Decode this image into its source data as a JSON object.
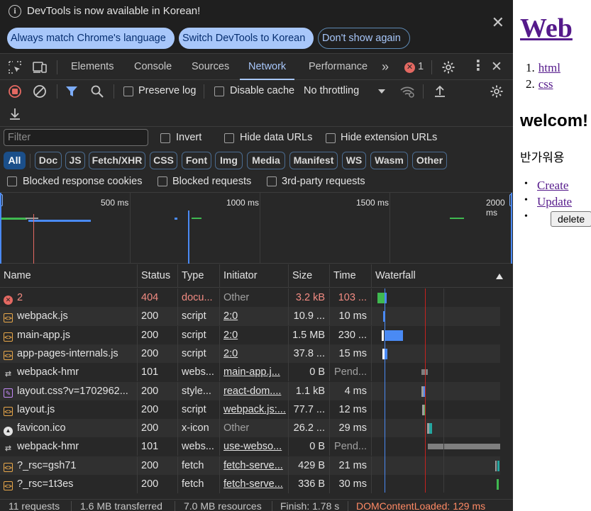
{
  "infobar": {
    "message": "DevTools is now available in Korean!",
    "always_match": "Always match Chrome's language",
    "switch_korean": "Switch DevTools to Korean",
    "dont_show": "Don't show again"
  },
  "tabs": [
    "Elements",
    "Console",
    "Sources",
    "Network",
    "Performance"
  ],
  "active_tab": "Network",
  "more_tabs_glyph": "»",
  "error_count": "1",
  "toolbar": {
    "preserve_log": "Preserve log",
    "disable_cache": "Disable cache",
    "throttling": "No throttling"
  },
  "filter": {
    "placeholder": "Filter",
    "invert": "Invert",
    "hide_data_urls": "Hide data URLs",
    "hide_extension_urls": "Hide extension URLs",
    "types": [
      "All",
      "Doc",
      "JS",
      "Fetch/XHR",
      "CSS",
      "Font",
      "Img",
      "Media",
      "Manifest",
      "WS",
      "Wasm",
      "Other"
    ],
    "blocked_response_cookies": "Blocked response cookies",
    "blocked_requests": "Blocked requests",
    "third_party": "3rd-party requests"
  },
  "overview": {
    "ticks": [
      "500 ms",
      "1000 ms",
      "1500 ms",
      "2000 ms"
    ]
  },
  "columns": {
    "name": "Name",
    "status": "Status",
    "type": "Type",
    "initiator": "Initiator",
    "size": "Size",
    "time": "Time",
    "waterfall": "Waterfall"
  },
  "rows": [
    {
      "name": "2",
      "status": "404",
      "type": "docu...",
      "initiator": "Other",
      "size": "3.2 kB",
      "time": "103 ...",
      "kind": "error"
    },
    {
      "name": "webpack.js",
      "status": "200",
      "type": "script",
      "initiator": "2:0",
      "size": "10.9 ...",
      "time": "10 ms",
      "kind": "script"
    },
    {
      "name": "main-app.js",
      "status": "200",
      "type": "script",
      "initiator": "2:0",
      "size": "1.5 MB",
      "time": "230 ...",
      "kind": "script"
    },
    {
      "name": "app-pages-internals.js",
      "status": "200",
      "type": "script",
      "initiator": "2:0",
      "size": "37.8 ...",
      "time": "15 ms",
      "kind": "script"
    },
    {
      "name": "webpack-hmr",
      "status": "101",
      "type": "webs...",
      "initiator": "main-app.j...",
      "size": "0 B",
      "time": "Pend...",
      "kind": "ws"
    },
    {
      "name": "layout.css?v=1702962...",
      "status": "200",
      "type": "style...",
      "initiator": "react-dom....",
      "size": "1.1 kB",
      "time": "4 ms",
      "kind": "css"
    },
    {
      "name": "layout.js",
      "status": "200",
      "type": "script",
      "initiator": "webpack.js:...",
      "size": "77.7 ...",
      "time": "12 ms",
      "kind": "script"
    },
    {
      "name": "favicon.ico",
      "status": "200",
      "type": "x-icon",
      "initiator": "Other",
      "size": "26.2 ...",
      "time": "29 ms",
      "kind": "img"
    },
    {
      "name": "webpack-hmr",
      "status": "101",
      "type": "webs...",
      "initiator": "use-webso...",
      "size": "0 B",
      "time": "Pend...",
      "kind": "ws"
    },
    {
      "name": "?_rsc=gsh71",
      "status": "200",
      "type": "fetch",
      "initiator": "fetch-serve...",
      "size": "429 B",
      "time": "21 ms",
      "kind": "script"
    },
    {
      "name": "?_rsc=1t3es",
      "status": "200",
      "type": "fetch",
      "initiator": "fetch-serve...",
      "size": "336 B",
      "time": "30 ms",
      "kind": "script"
    }
  ],
  "status_bar": {
    "requests": "11 requests",
    "transferred": "1.6 MB transferred",
    "resources": "7.0 MB resources",
    "finish": "Finish: 1.78 s",
    "dcl": "DOMContentLoaded: 129 ms"
  },
  "page": {
    "title": "Web",
    "nav": [
      "html",
      "css"
    ],
    "heading": "welcom!",
    "paragraph": "반가워용",
    "links": [
      "Create",
      "Update"
    ],
    "delete_button": "delete"
  },
  "colors": {
    "accent": "#a8c7fa",
    "error": "#f28b82",
    "dcl": "#ff8a65",
    "panel_bg": "#282828"
  }
}
